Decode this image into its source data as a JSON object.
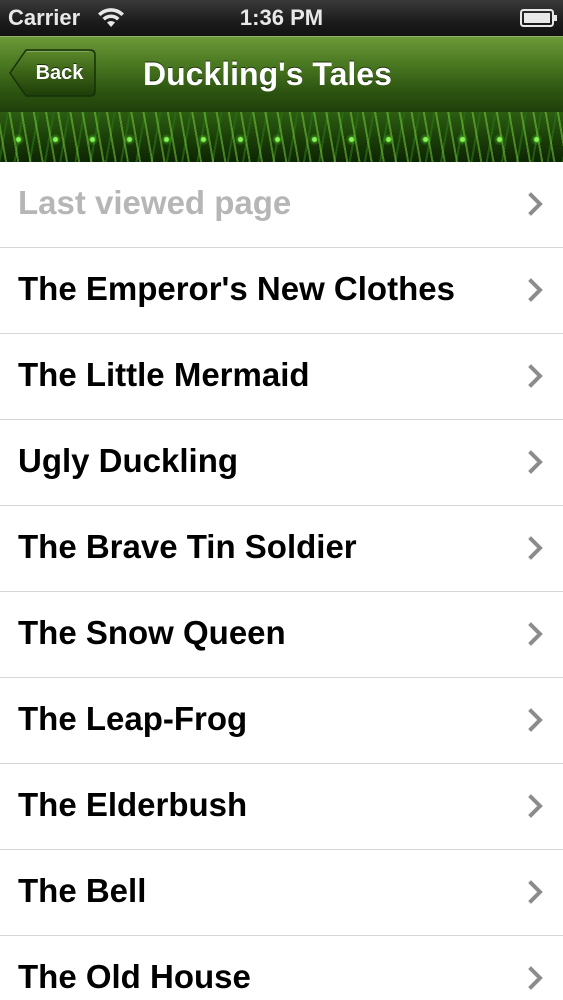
{
  "status_bar": {
    "carrier": "Carrier",
    "time": "1:36 PM",
    "icons": [
      "wifi-icon",
      "battery-icon"
    ]
  },
  "nav_bar": {
    "back_label": "Back",
    "title": "Duckling's Tales"
  },
  "list": {
    "items": [
      {
        "label": "Last viewed page",
        "muted": true
      },
      {
        "label": "The Emperor's New Clothes"
      },
      {
        "label": "The Little Mermaid"
      },
      {
        "label": "Ugly Duckling"
      },
      {
        "label": "The Brave Tin Soldier"
      },
      {
        "label": "The Snow Queen"
      },
      {
        "label": "The Leap-Frog"
      },
      {
        "label": "The Elderbush"
      },
      {
        "label": "The Bell"
      },
      {
        "label": "The Old House"
      }
    ],
    "row_icon": "chevron-right-icon"
  },
  "colors": {
    "nav_green": "#4c7a22",
    "muted_text": "#b6b6b6",
    "chevron": "#8c8c8c"
  }
}
